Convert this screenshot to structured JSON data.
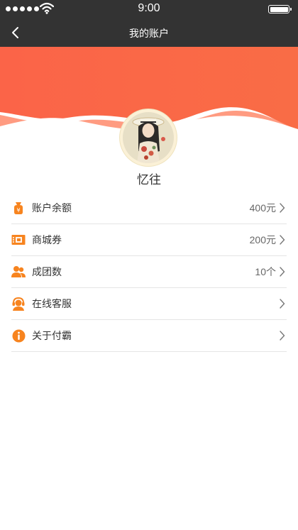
{
  "status_bar": {
    "time": "9:00",
    "signal_dots": 5
  },
  "nav": {
    "title": "我的账户",
    "back_icon": "chevron-left-icon"
  },
  "colors": {
    "header_bg": "#333333",
    "hero_orange": "#fb6a47",
    "hero_orange_light": "#ff8266",
    "icon_orange": "#f7841f",
    "divider": "#e5e5e5"
  },
  "profile": {
    "username": "忆往",
    "avatar_icon": "user-avatar-photo"
  },
  "menu": {
    "items": [
      {
        "id": "balance",
        "label": "账户余额",
        "value": "400元",
        "icon": "money-bag-icon"
      },
      {
        "id": "coupon",
        "label": "商城券",
        "value": "200元",
        "icon": "ticket-icon"
      },
      {
        "id": "group",
        "label": "成团数",
        "value": "10个",
        "icon": "group-users-icon"
      },
      {
        "id": "service",
        "label": "在线客服",
        "value": "",
        "icon": "customer-service-icon"
      },
      {
        "id": "about",
        "label": "关于付霸",
        "value": "",
        "icon": "info-icon"
      }
    ]
  }
}
